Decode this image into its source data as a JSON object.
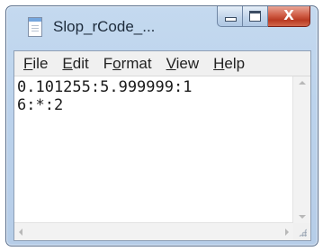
{
  "window": {
    "title": "Slop_rCode_...",
    "close_glyph": "X",
    "icons": {
      "app": "notepad-document-icon",
      "minimize": "minimize-icon",
      "maximize": "maximize-icon",
      "close": "close-icon"
    }
  },
  "menu": {
    "items": [
      "File",
      "Edit",
      "Format",
      "View",
      "Help"
    ],
    "mnemonic_underlined": true
  },
  "editor": {
    "lines": [
      "0.101255:5.999999:1",
      "6:*:2"
    ]
  },
  "scrollbars": {
    "vertical_icons": [
      "scroll-up-arrow-icon",
      "scroll-down-arrow-icon"
    ],
    "horizontal_icons": [
      "scroll-left-arrow-icon",
      "scroll-right-arrow-icon"
    ],
    "grip_icon": "size-grip-icon"
  },
  "colors": {
    "frame": "#bcd3ec",
    "close_button": "#c8482f",
    "menubar": "#f0f0f0",
    "editor_bg": "#ffffff",
    "text": "#1a1a1a"
  }
}
